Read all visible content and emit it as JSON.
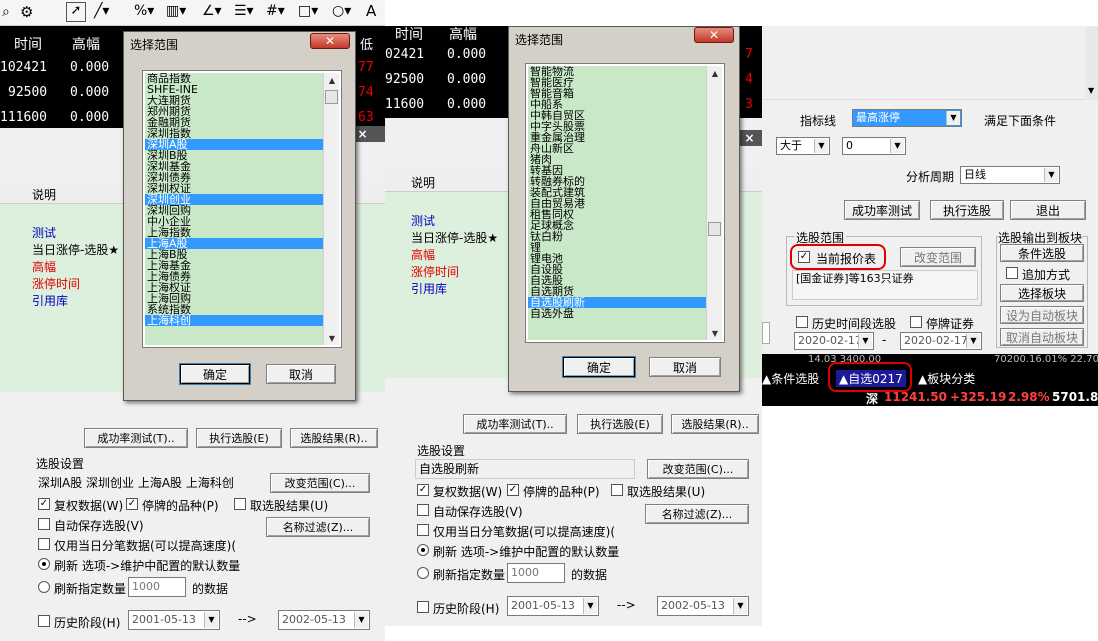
{
  "panel1": {
    "toolbar": {
      "icons": [
        "search-icon",
        "gear-icon",
        "cursor-icon",
        "line-icon",
        "percent-icon",
        "grid-icon",
        "angle-icon",
        "align-icon",
        "hash-icon",
        "rect-icon",
        "circle-icon",
        "text-icon"
      ],
      "text_tool": "A"
    },
    "quote_header": [
      "时间",
      "高幅"
    ],
    "quote_rows": [
      [
        "102421",
        "0.000"
      ],
      [
        "92500",
        "0.000"
      ],
      [
        "111600",
        "0.000"
      ]
    ],
    "side_digits": [
      "低",
      "77",
      "74",
      "63"
    ],
    "list_header": "说明",
    "items": [
      {
        "label": "测试",
        "color": "blue"
      },
      {
        "label": "当日涨停-选股★",
        "color": "black"
      },
      {
        "label": "高幅",
        "color": "red"
      },
      {
        "label": "涨停时间",
        "color": "red"
      },
      {
        "label": "引用库",
        "color": "blue"
      }
    ],
    "buttons": {
      "success_test": "成功率测试(T)..",
      "exec": "执行选股(E)",
      "result": "选股结果(R).."
    },
    "settings": {
      "title": "选股设置",
      "range_text": "深圳A股  深圳创业  上海A股  上海科创",
      "change_range": "改变范围(C)...",
      "name_filter": "名称过滤(Z)...",
      "cb_restore": "复权数据(W)",
      "cb_suspend": "停牌的品种(P)",
      "cb_take": "取选股结果(U)",
      "cb_autosave": "自动保存选股(V)",
      "cb_tick": "仅用当日分笔数据(可以提高速度)(",
      "radio_refresh": "刷新 选项->维护中配置的默认数量",
      "radio_specified": "刷新指定数量",
      "count": "1000",
      "count_suffix": "的数据",
      "history": "历史阶段(H)",
      "date_from": "2001-05-13",
      "arrow": "-->",
      "date_to": "2002-05-13"
    },
    "dialog": {
      "title": "选择范围",
      "items": [
        "商品指数",
        "SHFE-INE",
        "大连期货",
        "郑州期货",
        "金融期货",
        "深圳指数",
        "深圳A股",
        "深圳B股",
        "深圳基金",
        "深圳债券",
        "深圳权证",
        "深圳创业",
        "深圳回购",
        "中小企业",
        "上海指数",
        "上海A股",
        "上海B股",
        "上海基金",
        "上海债券",
        "上海权证",
        "上海回购",
        "系统指数",
        "上海科创"
      ],
      "selected": [
        "深圳A股",
        "深圳创业",
        "上海A股",
        "上海科创"
      ],
      "ok": "确定",
      "cancel": "取消"
    }
  },
  "panel2": {
    "quote_header": [
      "时间",
      "高幅"
    ],
    "quote_rows": [
      [
        "02421",
        "0.000"
      ],
      [
        "92500",
        "0.000"
      ],
      [
        "11600",
        "0.000"
      ]
    ],
    "side_digits": [
      "7",
      "4",
      "3"
    ],
    "list_header": "说明",
    "items": [
      {
        "label": "测试",
        "color": "blue"
      },
      {
        "label": "当日涨停-选股★",
        "color": "black"
      },
      {
        "label": "高幅",
        "color": "red"
      },
      {
        "label": "涨停时间",
        "color": "red"
      },
      {
        "label": "引用库",
        "color": "blue"
      }
    ],
    "buttons": {
      "success_test": "成功率测试(T)..",
      "exec": "执行选股(E)",
      "result": "选股结果(R).."
    },
    "settings": {
      "title": "选股设置",
      "range_text": "自选股刷新",
      "change_range": "改变范围(C)...",
      "name_filter": "名称过滤(Z)...",
      "cb_restore": "复权数据(W)",
      "cb_suspend": "停牌的品种(P)",
      "cb_take": "取选股结果(U)",
      "cb_autosave": "自动保存选股(V)",
      "cb_tick": "仅用当日分笔数据(可以提高速度)(",
      "radio_refresh": "刷新 选项->维护中配置的默认数量",
      "radio_specified": "刷新指定数量",
      "count": "1000",
      "count_suffix": "的数据",
      "history": "历史阶段(H)",
      "date_from": "2001-05-13",
      "arrow": "-->",
      "date_to": "2002-05-13"
    },
    "dialog": {
      "title": "选择范围",
      "items": [
        "智能物流",
        "智能医疗",
        "智能音箱",
        "中船系",
        "中韩自贸区",
        "中字头股票",
        "重金属治理",
        "舟山新区",
        "猪肉",
        "转基因",
        "转融券标的",
        "装配式建筑",
        "自由贸易港",
        "租售同权",
        "足球概念",
        "钛白粉",
        "锂",
        "锂电池",
        "自设股",
        "自选股",
        "自选期货",
        "自选股刷新",
        "自选外盘"
      ],
      "selected": [
        "自选股刷新"
      ],
      "ok": "确定",
      "cancel": "取消"
    }
  },
  "panel3": {
    "indicator_label": "指标线",
    "indicator_value": "最高涨停",
    "condition_label": "满足下面条件",
    "op_value": "大于",
    "num_value": "0",
    "period_label": "分析周期",
    "period_value": "日线",
    "buttons": {
      "success_test": "成功率测试",
      "exec": "执行选股",
      "exit": "退出"
    },
    "range_group": "选股范围",
    "current_quote": "当前报价表",
    "change_range": "改变范围",
    "range_info": "[国金证券]等163只证券",
    "output_group": "选股输出到板块",
    "cond_select": "条件选股",
    "append_mode": "追加方式",
    "select_block": "选择板块",
    "set_auto_block": "设为自动板块",
    "cancel_auto_block": "取消自动板块",
    "history_select": "历史时间段选股",
    "suspended": "停牌证券",
    "date_from": "2020-02-17",
    "date_sep": "-",
    "date_to": "2020-02-17",
    "tabs": [
      {
        "label": "▲条件选股"
      },
      {
        "label": "▲自选0217"
      },
      {
        "label": "▲板块分类"
      }
    ],
    "top_partial": "14.03     3400.00        ",
    "top_partial_right": "70200.16.01%   22.70",
    "index_name": "深",
    "index_value": "11241.50",
    "index_change": "+325.19",
    "index_pct": "2.98%",
    "index_amount": "5701.8"
  },
  "colors": {
    "list_bg": "#c8e8c8",
    "selected": "#3399ff",
    "highlight_red": "#e00000",
    "dark": "#000000"
  }
}
